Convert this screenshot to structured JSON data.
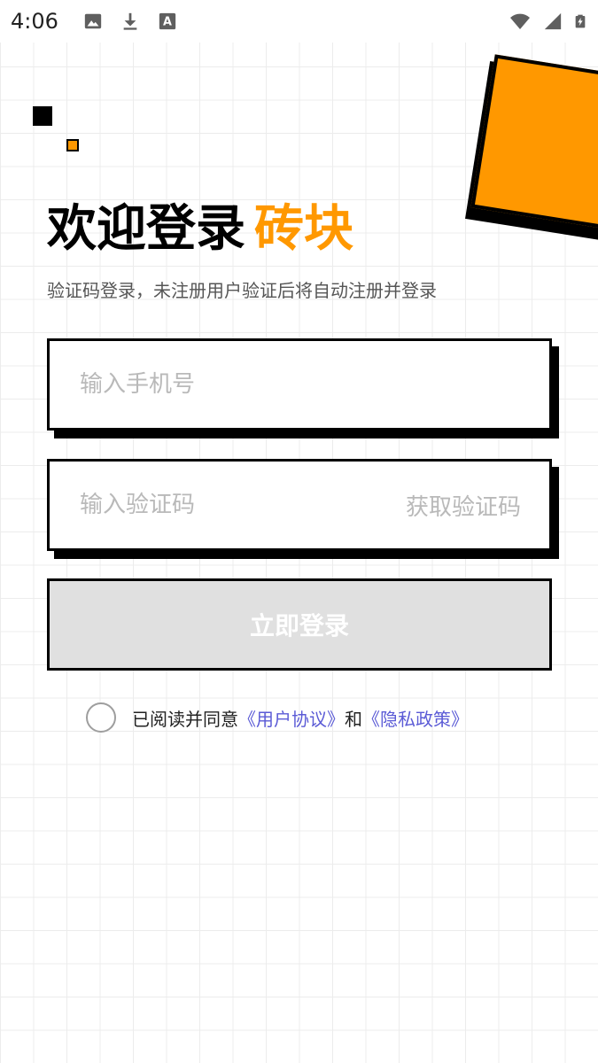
{
  "status_bar": {
    "time": "4:06",
    "left_icons": [
      "image-icon",
      "download-icon",
      "font-a-icon"
    ],
    "right_icons": [
      "wifi-icon",
      "cell-signal-icon",
      "battery-charging-icon"
    ]
  },
  "colors": {
    "accent": "#ff9800",
    "link": "#5b5bd6",
    "placeholder": "#b9b9b9",
    "button_disabled": "#e0e0e0"
  },
  "login": {
    "title_main": "欢迎登录",
    "title_brand": "砖块",
    "subtitle": "验证码登录，未注册用户验证后将自动注册并登录",
    "phone": {
      "value": "",
      "placeholder": "输入手机号"
    },
    "code": {
      "value": "",
      "placeholder": "输入验证码",
      "get_code_label": "获取验证码"
    },
    "submit_label": "立即登录",
    "agreement": {
      "checked": false,
      "prefix": "已阅读并同意",
      "terms_link": "《用户协议》",
      "conjunction": "和",
      "privacy_link": "《隐私政策》"
    }
  }
}
